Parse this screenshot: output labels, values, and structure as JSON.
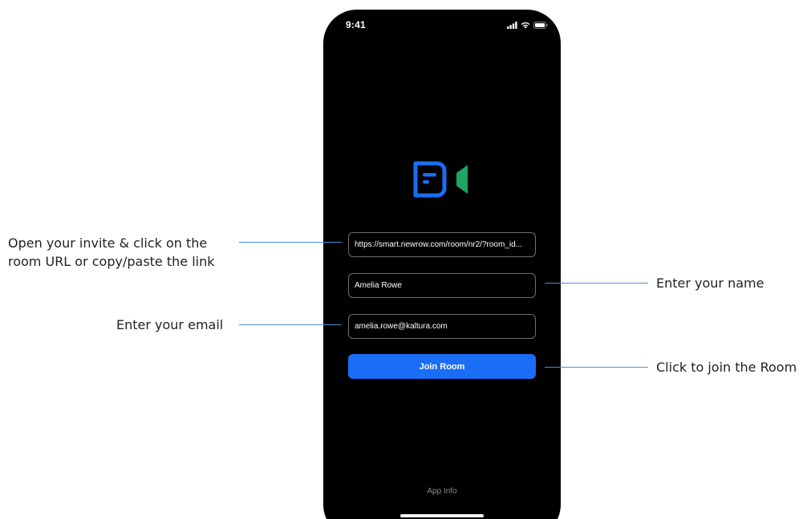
{
  "status_bar": {
    "time": "9:41"
  },
  "icons": {
    "signal": "signal-icon",
    "wifi": "wifi-icon",
    "battery": "battery-icon",
    "logo": "video-chat-logo"
  },
  "colors": {
    "logo_blue": "#1a6ef5",
    "logo_green": "#1fa463",
    "button_blue": "#1a6ef5",
    "callout_line": "#4a90d9"
  },
  "form": {
    "room_url_value": "https://smart.newrow.com/room/nr2/?room_id...",
    "name_value": "Amelia Rowe",
    "email_value": "amelia.rowe@kaltura.com",
    "join_label": "Join Room"
  },
  "footer": {
    "app_info_label": "App Info"
  },
  "annotations": {
    "url_line1": "Open your invite & click on the",
    "url_line2": "room URL or copy/paste the link",
    "name": "Enter your name",
    "email": "Enter your email",
    "join": "Click to join the Room"
  }
}
